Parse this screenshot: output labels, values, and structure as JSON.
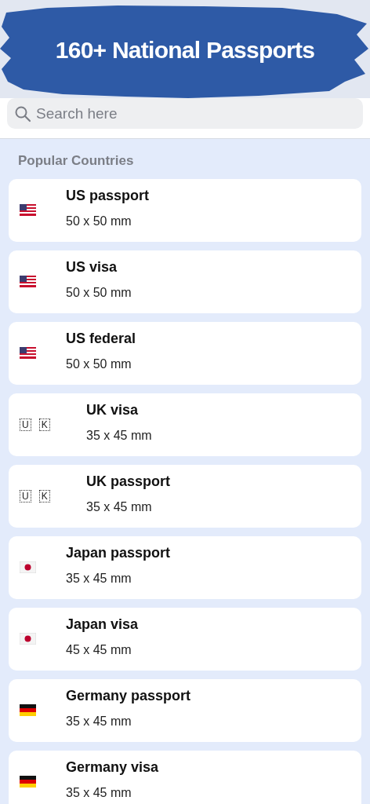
{
  "header": {
    "title": "160+ National Passports"
  },
  "search": {
    "placeholder": "Search here"
  },
  "section": {
    "title": "Popular Countries"
  },
  "items": [
    {
      "kind": "us",
      "name": "US passport",
      "size": "50 x 50 mm"
    },
    {
      "kind": "us",
      "name": "US visa",
      "size": "50 x 50 mm"
    },
    {
      "kind": "us",
      "name": "US federal",
      "size": "50 x 50 mm"
    },
    {
      "kind": "letters",
      "letters": [
        "U",
        "K"
      ],
      "name": "UK visa",
      "size": "35 x 45 mm"
    },
    {
      "kind": "letters",
      "letters": [
        "U",
        "K"
      ],
      "name": "UK passport",
      "size": "35 x 45 mm"
    },
    {
      "kind": "jp",
      "name": "Japan passport",
      "size": "35 x 45 mm"
    },
    {
      "kind": "jp",
      "name": "Japan visa",
      "size": "45 x 45 mm"
    },
    {
      "kind": "de",
      "name": "Germany passport",
      "size": "35 x 45 mm"
    },
    {
      "kind": "de",
      "name": "Germany visa",
      "size": "35 x 45 mm"
    }
  ]
}
